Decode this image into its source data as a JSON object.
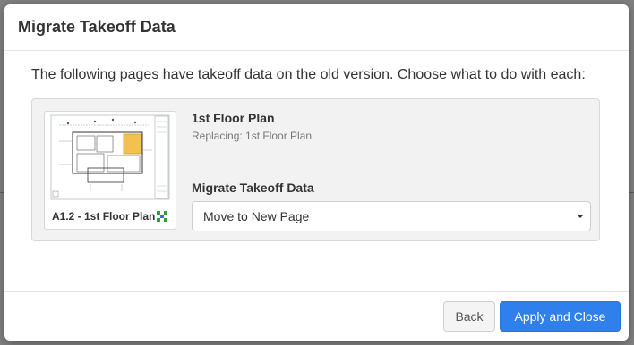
{
  "dialog": {
    "title": "Migrate Takeoff Data",
    "intro": "The following pages have takeoff data on the old version. Choose what to do with each:"
  },
  "pages": [
    {
      "thumbnail_label": "A1.2 - 1st Floor Plan",
      "name": "1st Floor Plan",
      "replacing": "Replacing: 1st Floor Plan",
      "migrate_label": "Migrate Takeoff Data",
      "migrate_selected": "Move to New Page"
    }
  ],
  "footer": {
    "back_label": "Back",
    "apply_label": "Apply and Close"
  },
  "colors": {
    "primary": "#2f80ed",
    "highlight_room": "#f2c14e"
  },
  "icons": {
    "select_caret": "caret-down-icon",
    "thumbnail_badge": "grid-markers-icon"
  }
}
